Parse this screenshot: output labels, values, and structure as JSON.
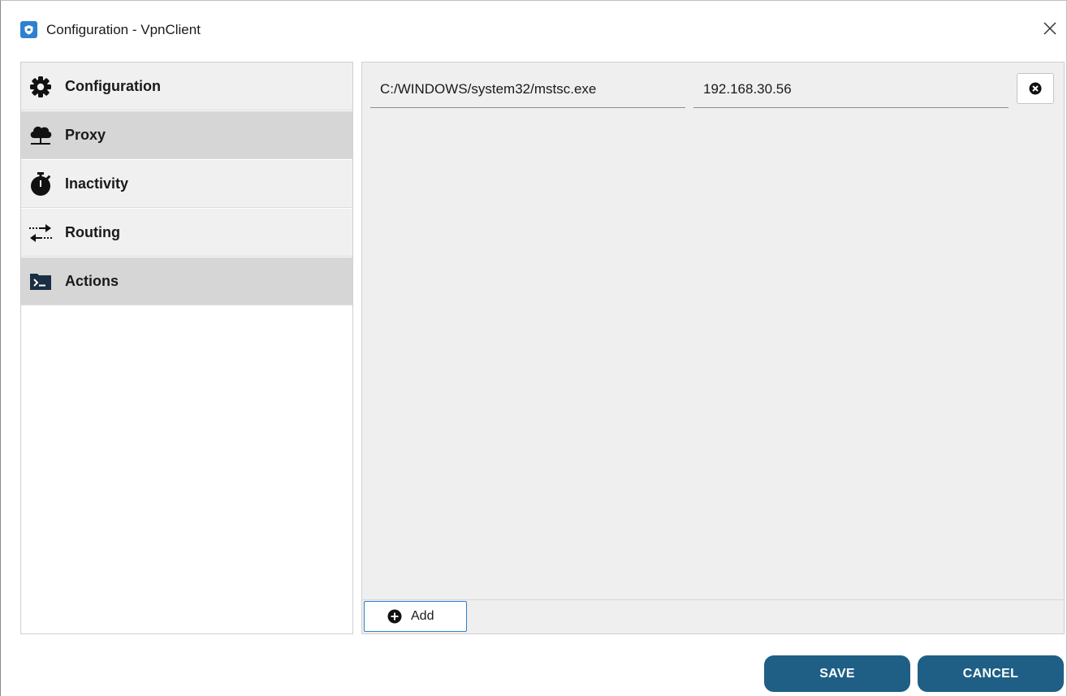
{
  "window": {
    "title": "Configuration - VpnClient",
    "app_icon": "shield-icon",
    "close_icon": "close-icon"
  },
  "sidebar": {
    "items": [
      {
        "label": "Configuration",
        "icon": "gear-icon",
        "active": false
      },
      {
        "label": "Proxy",
        "icon": "cloud-network-icon",
        "active": true
      },
      {
        "label": "Inactivity",
        "icon": "stopwatch-icon",
        "active": false
      },
      {
        "label": "Routing",
        "icon": "swap-arrows-icon",
        "active": false
      },
      {
        "label": "Actions",
        "icon": "terminal-icon",
        "active": true
      }
    ]
  },
  "actions": {
    "rows": [
      {
        "program": "C:/WINDOWS/system32/mstsc.exe",
        "address": "192.168.30.56",
        "remove_icon": "remove-circle-icon"
      }
    ],
    "add_label": "Add",
    "add_icon": "add-circle-icon"
  },
  "buttons": {
    "save": "SAVE",
    "cancel": "CANCEL"
  },
  "colors": {
    "accent": "#1f5f86",
    "app_icon": "#2f80d1",
    "nav_active": "#d6d6d6",
    "nav_default": "#f0f0f0",
    "panel_bg": "#efefef"
  }
}
